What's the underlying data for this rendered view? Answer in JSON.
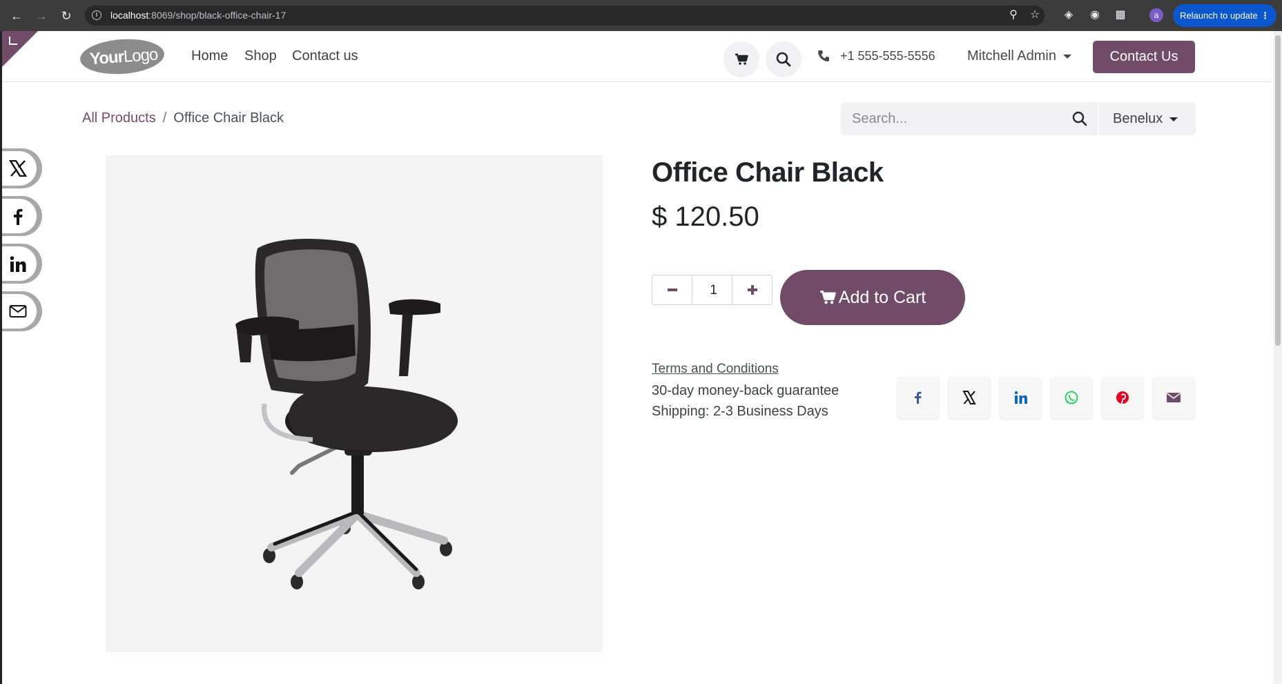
{
  "browser": {
    "url_host": "localhost",
    "url_rest": ":8069/shop/black-office-chair-17",
    "profile_initial": "a",
    "relaunch_label": "Relaunch to update"
  },
  "header": {
    "logo_bold": "Your",
    "logo_rest": "Logo",
    "menu": [
      "Home",
      "Shop",
      "Contact us"
    ],
    "phone": "+1 555-555-5556",
    "user": "Mitchell Admin",
    "contact_button": "Contact Us"
  },
  "breadcrumb": {
    "parent": "All Products",
    "separator": "/",
    "current": "Office Chair Black"
  },
  "search": {
    "placeholder": "Search...",
    "pricelist": "Benelux"
  },
  "product": {
    "name": "Office Chair Black",
    "price": "$ 120.50",
    "quantity": "1",
    "add_to_cart": "Add to Cart",
    "terms_link": "Terms and Conditions",
    "guarantee": "30-day money-back guarantee",
    "shipping": "Shipping: 2-3 Business Days"
  },
  "share_float": [
    "x-icon",
    "facebook-icon",
    "linkedin-icon",
    "email-icon"
  ],
  "share_buttons": [
    "facebook-icon",
    "x-icon",
    "linkedin-icon",
    "whatsapp-icon",
    "pinterest-icon",
    "email-icon"
  ],
  "colors": {
    "brand": "#714b67",
    "facebook": "#3b5998",
    "linkedin": "#0a66c2",
    "whatsapp": "#25d366",
    "pinterest": "#e60023"
  }
}
